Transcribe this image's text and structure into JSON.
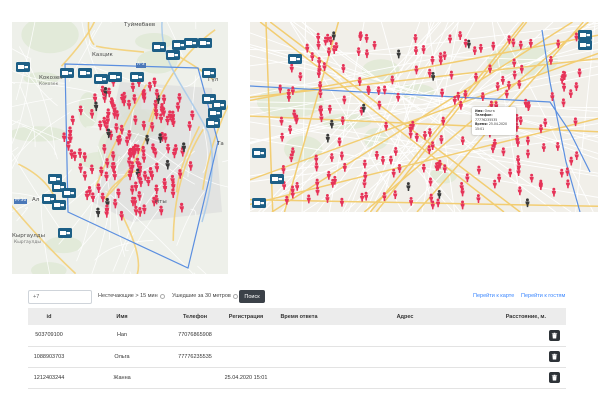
{
  "map_left": {
    "labels": {
      "tuymebayev": "Туймебаев",
      "kazykh": "Казцик",
      "kokozek": "Кокозек",
      "kokozek_ru": "Кокозек",
      "kyrgauldy": "Кыргаулды",
      "kyrgauldy_ru": "Кыргаулды",
      "am_m36": "М-36",
      "am_a3": "А-3",
      "guly": "Гүл",
      "zmty": "мты",
      "ai": "Ал",
      "ta": "Та"
    }
  },
  "map_right": {
    "popup": {
      "name_label": "Имя:",
      "name_value": "Ольга",
      "phone_label": "Телефон:",
      "phone_value": "77776235535",
      "time_label": "Время:",
      "time_value": "25.04.2020 15:01"
    }
  },
  "toolbar": {
    "search_value": "+7",
    "filter_unattended": "Нестечающие > 15 мин",
    "filter_left": "Ушедшие за 30 метров",
    "search_button": "Поиск",
    "goto_map": "Перейти к карте",
    "goto_guests": "Перейти к гостям"
  },
  "table": {
    "headers": [
      "id",
      "Имя",
      "Телефон",
      "Регистрация",
      "Время ответа",
      "Адрес",
      "Расстояние, м."
    ],
    "rows": [
      {
        "id": "503709100",
        "name": "Han",
        "phone": "77076865908",
        "registration": "",
        "response": "",
        "address": "",
        "distance": ""
      },
      {
        "id": "1088903703",
        "name": "Ольга",
        "phone": "77776235535",
        "registration": "",
        "response": "",
        "address": "",
        "distance": ""
      },
      {
        "id": "1212403244",
        "name": "Жанна",
        "phone": "",
        "registration": "25.04.2020 15:01",
        "response": "",
        "address": "",
        "distance": ""
      }
    ]
  },
  "colors": {
    "marker": "#e63358",
    "marker_dark": "#3a3a3a",
    "camera_marker": "#1d5f86",
    "boundary": "#5b8fe0",
    "link": "#3a86ff",
    "button": "#3b4148"
  },
  "icons": {
    "person_marker": "person-marker-icon",
    "camera_marker": "camera-marker-icon",
    "trash": "trash-icon",
    "help": "help-circle-icon"
  }
}
